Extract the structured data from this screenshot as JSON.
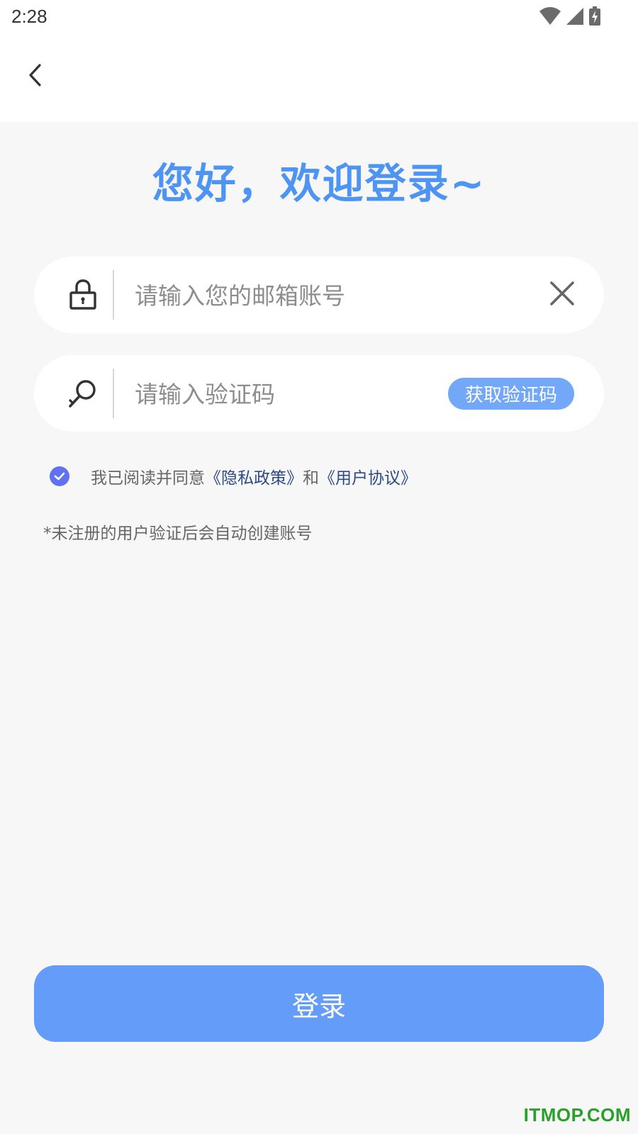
{
  "status_bar": {
    "time": "2:28",
    "icons": [
      "wifi-icon",
      "signal-icon",
      "battery-charging-icon"
    ]
  },
  "header": {
    "back_icon": "chevron-left-icon",
    "greeting": "您好，欢迎登录~"
  },
  "form": {
    "email": {
      "icon": "lock-icon",
      "placeholder": "请输入您的邮箱账号",
      "value": "",
      "clear_icon": "close-icon"
    },
    "code": {
      "icon": "search-icon",
      "placeholder": "请输入验证码",
      "value": "",
      "get_code_label": "获取验证码"
    },
    "agreement": {
      "checked": true,
      "prefix": "我已阅读并同意",
      "privacy_link": "《隐私政策》",
      "conjunction": "和",
      "terms_link": "《用户协议》"
    },
    "notice": "*未注册的用户验证后会自动创建账号",
    "login_label": "登录"
  },
  "watermark": "ITMOP.COM",
  "colors": {
    "accent": "#4d94f3",
    "login_button": "#649cf9",
    "code_button": "#72a8f7",
    "checkbox": "#6071f2",
    "link": "#2c4a86",
    "page_background": "#f7f7f7",
    "watermark": "#2aa02a"
  }
}
